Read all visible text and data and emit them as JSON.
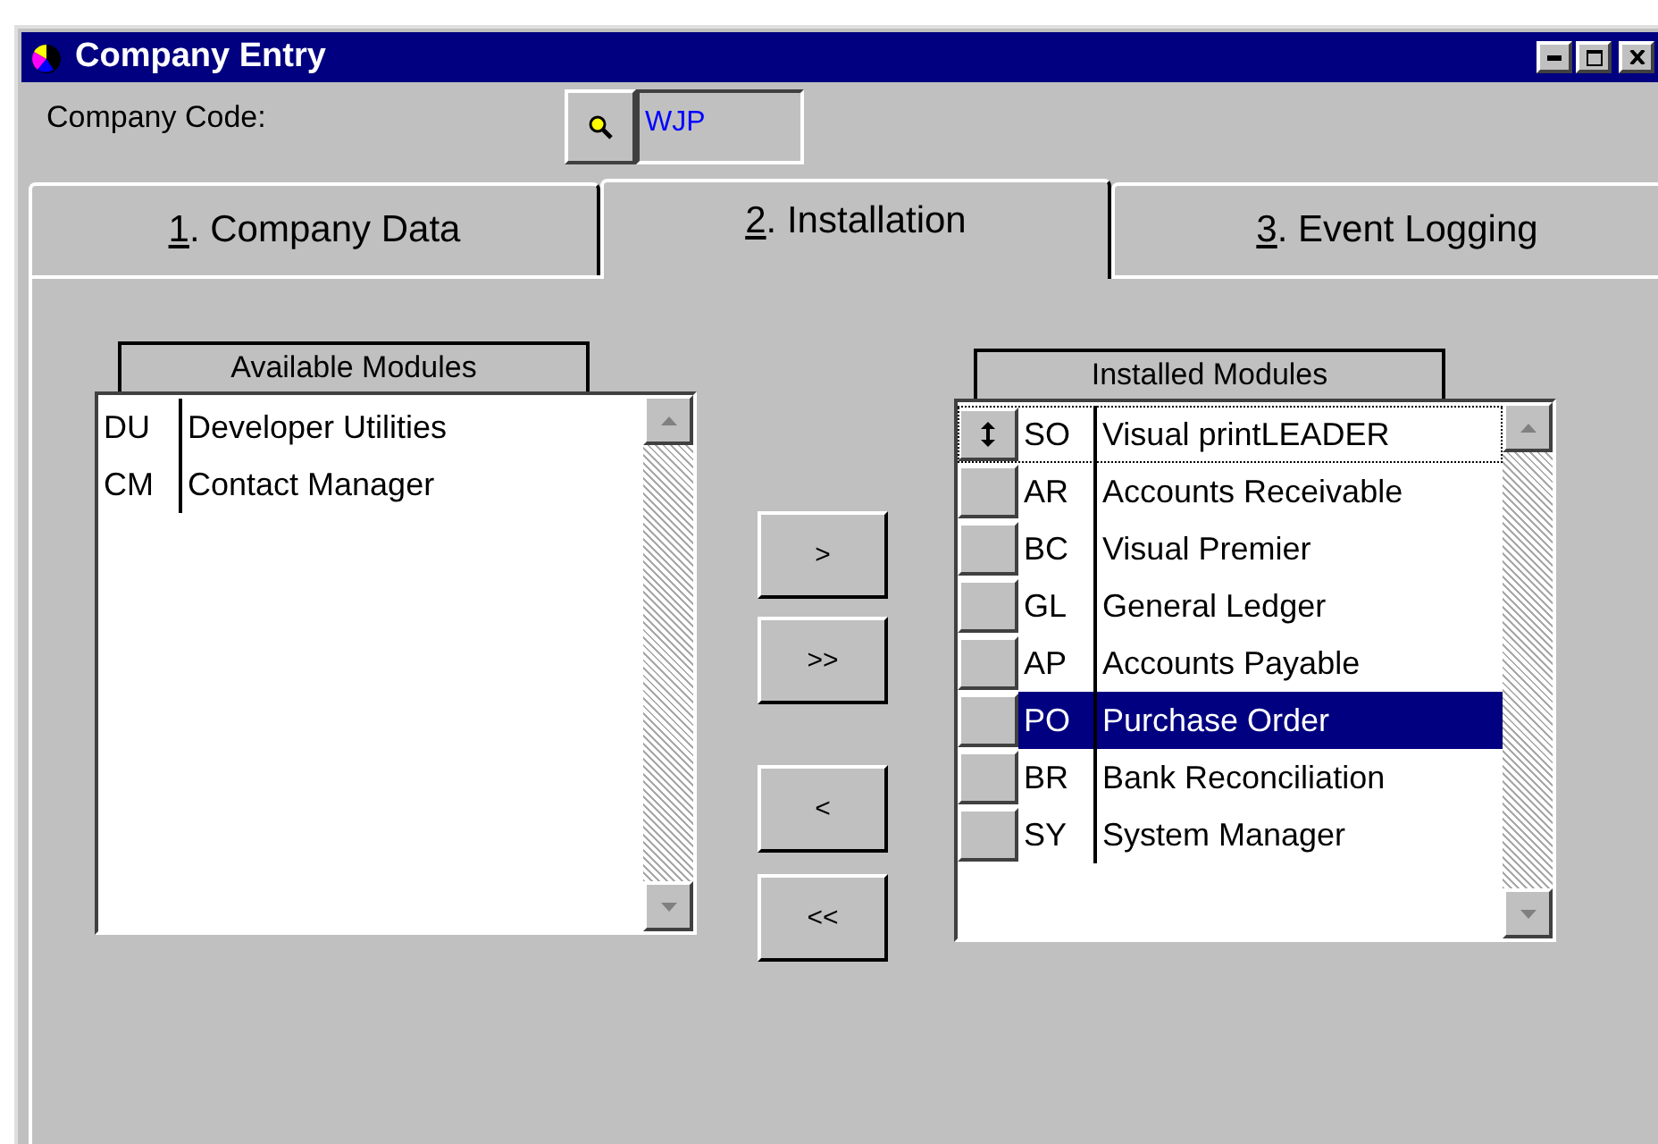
{
  "window": {
    "title": "Company Entry"
  },
  "company_code": {
    "label": "Company Code:",
    "value": "WJP"
  },
  "tabs": [
    {
      "key": "1",
      "label": ". Company Data",
      "selected": false
    },
    {
      "key": "2",
      "label": ". Installation",
      "selected": true
    },
    {
      "key": "3",
      "label": ". Event Logging",
      "selected": false
    }
  ],
  "available": {
    "header": "Available Modules",
    "rows": [
      {
        "code": "DU",
        "name": "Developer Utilities",
        "selected": false
      },
      {
        "code": "CM",
        "name": "Contact Manager",
        "selected": false
      }
    ]
  },
  "move_buttons": [
    ">",
    ">>",
    "<",
    "<<"
  ],
  "installed": {
    "header": "Installed Modules",
    "rows": [
      {
        "code": "SO",
        "name": "Visual printLEADER",
        "selected": false,
        "current": true
      },
      {
        "code": "AR",
        "name": "Accounts Receivable",
        "selected": false,
        "current": false
      },
      {
        "code": "BC",
        "name": "Visual Premier",
        "selected": false,
        "current": false
      },
      {
        "code": "GL",
        "name": "General Ledger",
        "selected": false,
        "current": false
      },
      {
        "code": "AP",
        "name": "Accounts Payable",
        "selected": false,
        "current": false
      },
      {
        "code": "PO",
        "name": "Purchase Order",
        "selected": true,
        "current": false
      },
      {
        "code": "BR",
        "name": "Bank Reconciliation",
        "selected": false,
        "current": false
      },
      {
        "code": "SY",
        "name": "System Manager",
        "selected": false,
        "current": false
      }
    ]
  }
}
